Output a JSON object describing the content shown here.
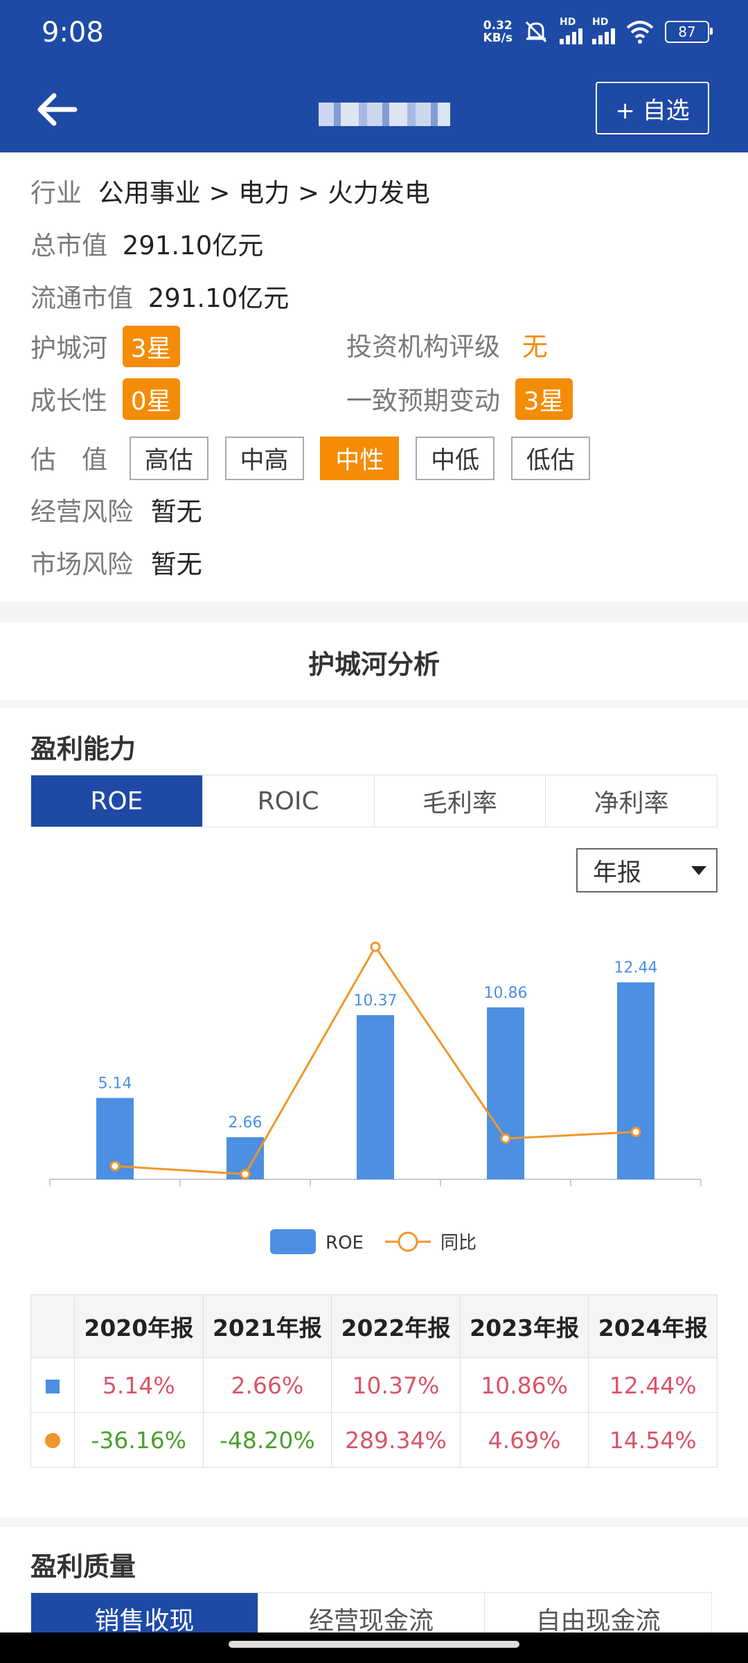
{
  "status": {
    "time": "9:08",
    "net_speed_value": "0.32",
    "net_speed_unit": "KB/s",
    "signal1_label": "HD",
    "signal2_label": "HD",
    "battery": "87"
  },
  "nav": {
    "add_watch_label": "+ 自选"
  },
  "info": {
    "industry_label": "行业",
    "industry_value": "公用事业 > 电力 > 火力发电",
    "market_cap_label": "总市值",
    "market_cap_value": "291.10亿元",
    "float_cap_label": "流通市值",
    "float_cap_value": "291.10亿元",
    "moat_label": "护城河",
    "moat_value": "3星",
    "rating_label": "投资机构评级",
    "rating_value": "无",
    "growth_label": "成长性",
    "growth_value": "0星",
    "forecast_label": "一致预期变动",
    "forecast_value": "3星",
    "valuation_label": "估　值",
    "valuation_options": [
      "高估",
      "中高",
      "中性",
      "中低",
      "低估"
    ],
    "valuation_selected": "中性",
    "op_risk_label": "经营风险",
    "op_risk_value": "暂无",
    "market_risk_label": "市场风险",
    "market_risk_value": "暂无"
  },
  "moat_section_title": "护城河分析",
  "profitability": {
    "title": "盈利能力",
    "tabs": [
      "ROE",
      "ROIC",
      "毛利率",
      "净利率"
    ],
    "active_tab": "ROE",
    "period_select": "年报"
  },
  "chart_data": {
    "type": "bar",
    "categories": [
      "2020年报",
      "2021年报",
      "2022年报",
      "2023年报",
      "2024年报"
    ],
    "series": [
      {
        "name": "ROE",
        "type": "bar",
        "values": [
          5.14,
          2.66,
          10.37,
          10.86,
          12.44
        ],
        "color": "#4c8fe3"
      },
      {
        "name": "同比",
        "type": "line",
        "values": [
          -36.16,
          -48.2,
          289.34,
          4.69,
          14.54
        ],
        "color": "#f0962a"
      }
    ],
    "data_labels": [
      "5.14",
      "2.66",
      "10.37",
      "10.86",
      "12.44"
    ],
    "legend": [
      "ROE",
      "同比"
    ],
    "legend_position": "bottom"
  },
  "table": {
    "headers": [
      "2020年报",
      "2021年报",
      "2022年报",
      "2023年报",
      "2024年报"
    ],
    "row_roe": [
      "5.14%",
      "2.66%",
      "10.37%",
      "10.86%",
      "12.44%"
    ],
    "row_yoy": [
      "-36.16%",
      "-48.20%",
      "289.34%",
      "4.69%",
      "14.54%"
    ]
  },
  "quality": {
    "title": "盈利质量",
    "tabs": [
      "销售收现",
      "经营现金流",
      "自由现金流"
    ],
    "active_tab": "销售收现"
  },
  "colors": {
    "header_blue": "#1e4aa6",
    "accent_orange": "#f48c06",
    "bar_blue": "#4c8fe3",
    "line_orange": "#f0962a",
    "positive_red": "#d9546a",
    "negative_green": "#4aa02c"
  }
}
